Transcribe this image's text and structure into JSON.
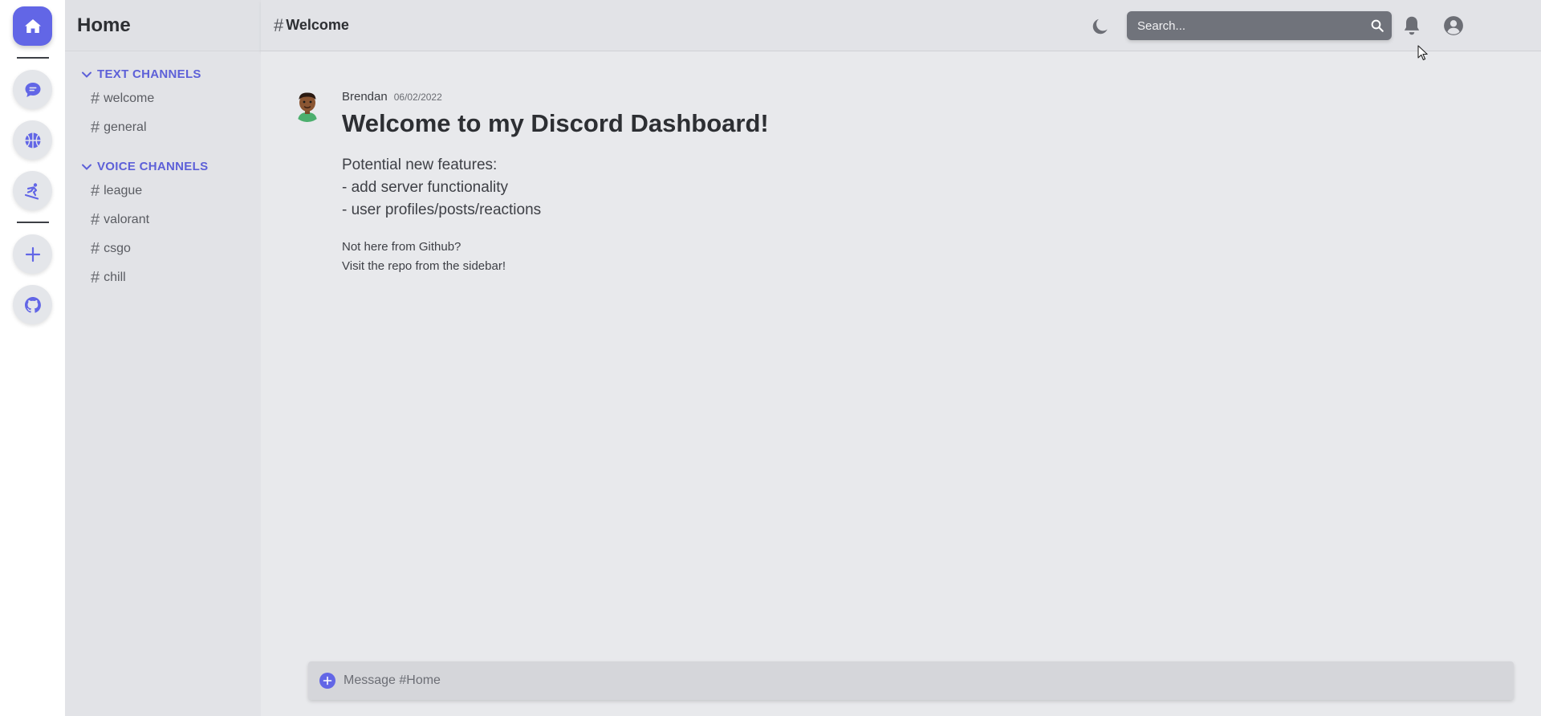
{
  "rail": {
    "items": [
      {
        "name": "home-server-button",
        "icon": "home-icon"
      },
      {
        "name": "chat-server-button",
        "icon": "chat-bubble-icon"
      },
      {
        "name": "basketball-server-button",
        "icon": "basketball-icon"
      },
      {
        "name": "snowboard-server-button",
        "icon": "snowboarding-icon"
      },
      {
        "name": "add-server-button",
        "icon": "plus-icon"
      },
      {
        "name": "github-button",
        "icon": "github-icon"
      }
    ],
    "accent": "#6266e6"
  },
  "sidebar": {
    "title": "Home",
    "text_category": "TEXT CHANNELS",
    "text_channels": [
      {
        "hash": "#",
        "label": "welcome"
      },
      {
        "hash": "#",
        "label": "general"
      }
    ],
    "voice_category": "VOICE CHANNELS",
    "voice_channels": [
      {
        "hash": "#",
        "label": "league"
      },
      {
        "hash": "#",
        "label": "valorant"
      },
      {
        "hash": "#",
        "label": "csgo"
      },
      {
        "hash": "#",
        "label": "chill"
      }
    ]
  },
  "topbar": {
    "hash": "#",
    "channel_title": "Welcome",
    "search_placeholder": "Search...",
    "icons": [
      "moon-icon",
      "search-icon",
      "bell-icon",
      "user-circle-icon"
    ]
  },
  "message": {
    "author": "Brendan",
    "date": "06/02/2022",
    "heading": "Welcome to my Discord Dashboard!",
    "lines": [
      "Potential new features:",
      "- add server functionality",
      "- user profiles/posts/reactions"
    ],
    "note_lines": [
      "Not here from Github?",
      "Visit the repo from the sidebar!"
    ]
  },
  "composer": {
    "placeholder": "Message #Home"
  }
}
